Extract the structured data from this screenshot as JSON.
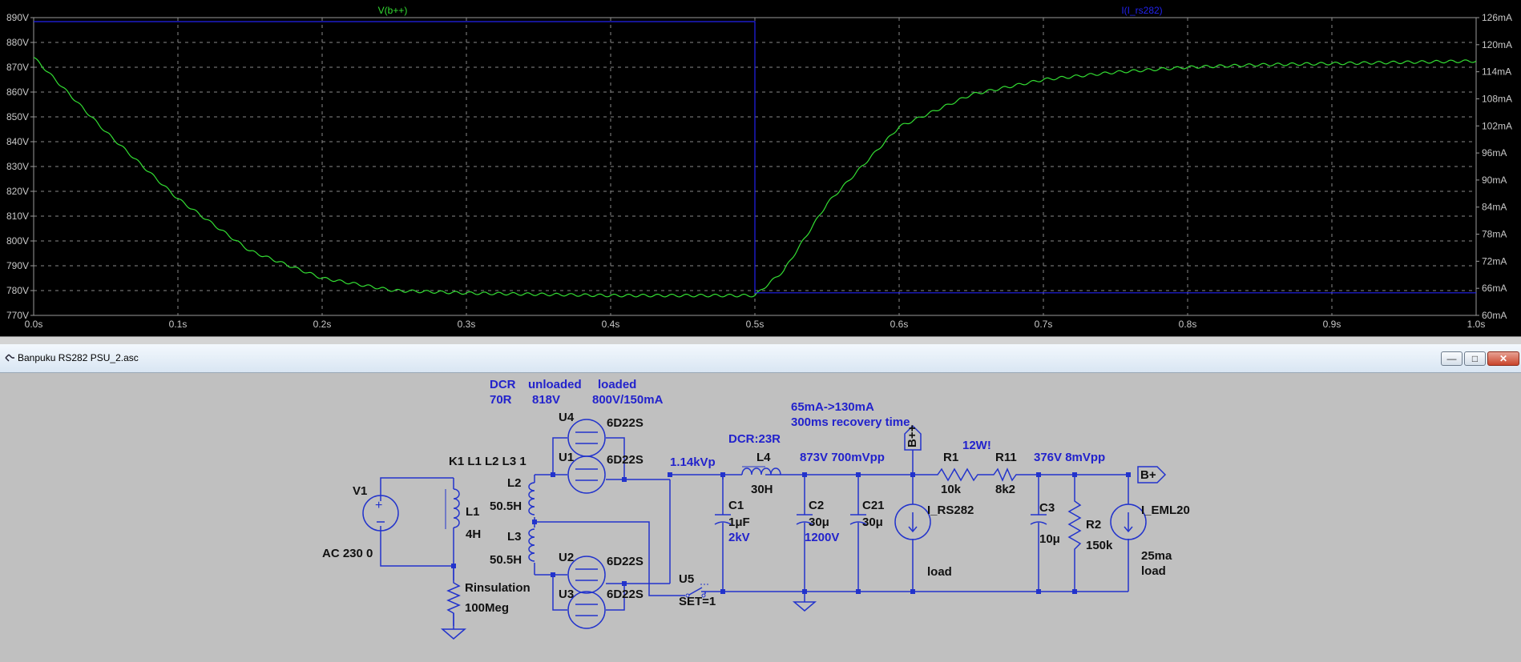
{
  "plot": {
    "traces": {
      "left": {
        "label": "V(b++)",
        "color": "#33dd33"
      },
      "right": {
        "label": "I(I_rs282)",
        "color": "#2222ee"
      }
    },
    "left_axis_ticks": [
      "890V",
      "880V",
      "870V",
      "860V",
      "850V",
      "840V",
      "830V",
      "820V",
      "810V",
      "800V",
      "790V",
      "780V",
      "770V"
    ],
    "right_axis_ticks": [
      "126mA",
      "120mA",
      "114mA",
      "108mA",
      "102mA",
      "96mA",
      "90mA",
      "84mA",
      "78mA",
      "72mA",
      "66mA",
      "60mA"
    ],
    "x_axis_ticks": [
      "0.0s",
      "0.1s",
      "0.2s",
      "0.3s",
      "0.4s",
      "0.5s",
      "0.6s",
      "0.7s",
      "0.8s",
      "0.9s",
      "1.0s"
    ]
  },
  "chart_data": {
    "type": "line",
    "xlim": [
      0,
      1.0
    ],
    "ylim_left": [
      770,
      890
    ],
    "ylim_right": [
      60,
      126
    ],
    "grid": true,
    "series": [
      {
        "name": "V(b++)",
        "axis": "left",
        "color": "#33dd33",
        "x": [
          0.0,
          0.02,
          0.05,
          0.1,
          0.15,
          0.2,
          0.25,
          0.3,
          0.35,
          0.4,
          0.45,
          0.5,
          0.52,
          0.55,
          0.6,
          0.65,
          0.7,
          0.75,
          0.8,
          0.85,
          0.9,
          0.95,
          1.0
        ],
        "y": [
          874,
          862,
          844,
          817,
          796,
          785,
          780,
          779,
          778.5,
          778,
          778,
          778,
          788,
          815,
          846,
          859,
          865,
          868,
          870,
          871,
          871.5,
          872,
          872.5
        ]
      },
      {
        "name": "I(I_rs282)",
        "axis": "right",
        "color": "#2222ee",
        "x": [
          0.0,
          0.5,
          0.5,
          1.0
        ],
        "y": [
          130,
          130,
          65,
          65
        ]
      }
    ]
  },
  "window": {
    "title": "Banpuku RS282 PSU_2.asc",
    "minimize": "—",
    "maximize": "□",
    "close": "✕"
  },
  "schematic": {
    "notes": {
      "dcr": "DCR",
      "dcr_val": "70R",
      "unloaded": "unloaded",
      "unloaded_val": "818V",
      "loaded": "loaded",
      "loaded_val": "800V/150mA",
      "load_change": "65mA->130mA",
      "recovery": "300ms recovery time",
      "dcr_l4": "DCR:23R",
      "v_rect": "1.14kVp",
      "v_bpp": "873V 700mVpp",
      "v_bp": "376V 8mVpp",
      "r1_power": "12W!",
      "c1_rating": "2kV",
      "c2_rating": "1200V"
    },
    "components": {
      "v1": "V1",
      "v1_value": "AC 230 0",
      "l1": "L1",
      "l1_value": "4H",
      "coupling": "K1 L1 L2 L3 1",
      "l2": "L2",
      "l2_value": "50.5H",
      "l3": "L3",
      "l3_value": "50.5H",
      "rins": "Rinsulation",
      "rins_value": "100Meg",
      "u1": "U1",
      "u2": "U2",
      "u3": "U3",
      "u4": "U4",
      "tube": "6D22S",
      "u5": "U5",
      "u5_value": "SET=1",
      "l4": "L4",
      "l4_value": "30H",
      "c1": "C1",
      "c1_value": "1μF",
      "c2": "C2",
      "c2_value": "30μ",
      "c21": "C21",
      "c21_value": "30μ",
      "i_rs282": "I_RS282",
      "i_rs282_note": "load",
      "bpp_flag": "B++",
      "r1": "R1",
      "r1_value": "10k",
      "r11": "R11",
      "r11_value": "8k2",
      "c3": "C3",
      "c3_value": "10μ",
      "r2": "R2",
      "r2_value": "150k",
      "i_eml20": "I_EML20",
      "i_eml20_val": "25ma",
      "i_eml20_note": "load",
      "bp_flag": "B+"
    }
  }
}
